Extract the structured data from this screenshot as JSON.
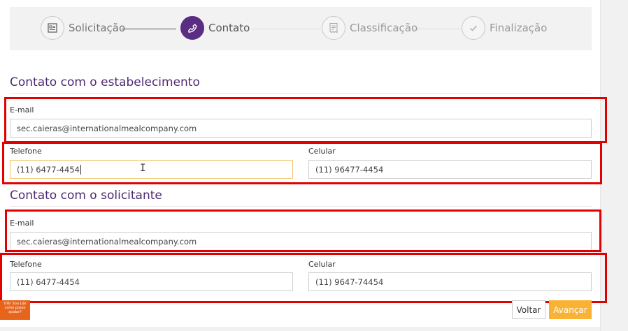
{
  "stepper": {
    "steps": [
      {
        "label": "Solicitação",
        "icon": "form-icon"
      },
      {
        "label": "Contato",
        "icon": "phone-icon"
      },
      {
        "label": "Classificação",
        "icon": "receipt-icon"
      },
      {
        "label": "Finalização",
        "icon": "check-icon"
      }
    ],
    "active_index": 1
  },
  "establishment": {
    "title": "Contato com o estabelecimento",
    "email_label": "E-mail",
    "email_value": "sec.caieras@internationalmealcompany.com",
    "phone_label": "Telefone",
    "phone_value": "(11) 6477-4454",
    "mobile_label": "Celular",
    "mobile_value": "(11) 96477-4454"
  },
  "requester": {
    "title": "Contato com o solicitante",
    "email_label": "E-mail",
    "email_value": "sec.caieras@internationalmealcompany.com",
    "phone_label": "Telefone",
    "phone_value": "(11) 6477-4454",
    "mobile_label": "Celular",
    "mobile_value": "(11) 9647-74454"
  },
  "actions": {
    "back_label": "Voltar",
    "next_label": "Avançar"
  },
  "help_badge": {
    "line1": "Olá! Sou Lúe",
    "line2": "como posso",
    "line3": "ajudar?"
  },
  "colors": {
    "accent_purple": "#5a2d82",
    "title_purple": "#4e2a73",
    "next_button": "#f9b233",
    "highlight_red": "#e30000"
  }
}
